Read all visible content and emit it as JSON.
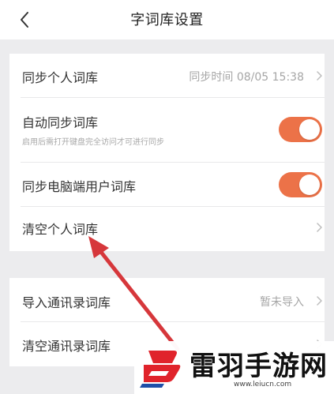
{
  "nav": {
    "title": "字词库设置",
    "back_icon": "chevron-left-icon"
  },
  "settings": [
    {
      "label": "同步个人词库",
      "value": "同步时间 08/05 15:38",
      "control": "chevron"
    },
    {
      "label": "自动同步词库",
      "sublabel": "启用后需打开键盘完全访问才可进行同步",
      "control": "toggle",
      "on": true
    },
    {
      "label": "同步电脑端用户词库",
      "control": "toggle",
      "on": true
    },
    {
      "label": "清空个人词库",
      "control": "chevron"
    }
  ],
  "contacts": [
    {
      "label": "导入通讯录词库",
      "value": "暂未导入",
      "control": "chevron"
    },
    {
      "label": "清空通讯录词库",
      "control": "chevron"
    }
  ],
  "watermark": {
    "name": "雷羽手游网",
    "url": "www.leiucn.com"
  },
  "colors": {
    "toggle_on": "#ec7248",
    "annotation_arrow": "#d6373b",
    "background": "#ececee"
  }
}
